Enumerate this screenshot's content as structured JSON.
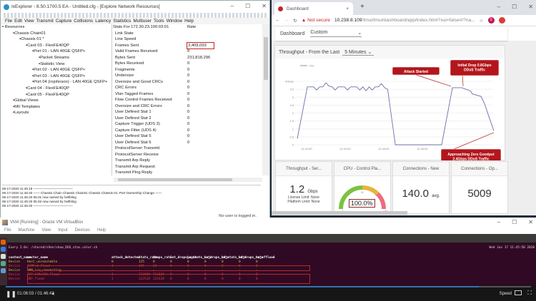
{
  "ixexplorer": {
    "title": "IxExplorer - 8.50.1700.5 EA - Untitled.cfg - [Explore Network Resources]",
    "menu": [
      "File",
      "Edit",
      "View",
      "Transmit",
      "Capture",
      "Collisions",
      "Latency",
      "Statistics",
      "Multiuser",
      "Tools",
      "Window",
      "Help"
    ],
    "tree": [
      {
        "label": "Resources",
        "level": 0
      },
      {
        "label": "Chassis Chain01",
        "level": 1
      },
      {
        "label": "Chassis 01 *",
        "level": 2
      },
      {
        "label": "Card 03 - FlexFE40QP",
        "level": 3
      },
      {
        "label": "Port 01  - LAN 40GE QSFP+",
        "level": 4
      },
      {
        "label": "Packet Streams",
        "level": 5
      },
      {
        "label": "Statistic View",
        "level": 5
      },
      {
        "label": "Port 02  - LAN 40GE QSFP+",
        "level": 4
      },
      {
        "label": "Port 03  - LAN 40GE QSFP+",
        "level": 4
      },
      {
        "label": "Port 04  (rojohnson)  - LAN 40GE QSFP+",
        "level": 4
      },
      {
        "label": "Card 04 - FlexFE40QP",
        "level": 3
      },
      {
        "label": "Card 05 - FlexFE40QP",
        "level": 3
      },
      {
        "label": "Global Views",
        "level": 1
      },
      {
        "label": "MII Templates",
        "level": 1
      },
      {
        "label": "Layouts",
        "level": 1
      }
    ],
    "stats_header": {
      "name": "Stats For 172.30.23.100:03:01",
      "value": "Rate"
    },
    "stats": [
      {
        "name": "Link State",
        "value": ""
      },
      {
        "name": "Line Speed",
        "value": ""
      },
      {
        "name": "Frames Sent",
        "value": "3,409,093",
        "highlight": true
      },
      {
        "name": "Valid Frames Received",
        "value": "0"
      },
      {
        "name": "Bytes Sent",
        "value": "231,818,296"
      },
      {
        "name": "Bytes Received",
        "value": "0"
      },
      {
        "name": "Fragments",
        "value": "0"
      },
      {
        "name": "Undersize",
        "value": "0"
      },
      {
        "name": "Oversize and Good CRCs",
        "value": "0"
      },
      {
        "name": "CRC Errors",
        "value": "0"
      },
      {
        "name": "Vlan Tagged Frames",
        "value": "0"
      },
      {
        "name": "Flow Control Frames Received",
        "value": "0"
      },
      {
        "name": "Oversize and CRC Errors",
        "value": "0"
      },
      {
        "name": "User Defined Stat 1",
        "value": "0"
      },
      {
        "name": "User Defined Stat 2",
        "value": "0"
      },
      {
        "name": "Capture Trigger (UDS 3)",
        "value": "0"
      },
      {
        "name": "Capture Filter (UDS 4)",
        "value": "0"
      },
      {
        "name": "User Defined Stat 5",
        "value": "0"
      },
      {
        "name": "User Defined Stat 6",
        "value": "0"
      },
      {
        "name": "ProtocolServer Transmit",
        "value": ""
      },
      {
        "name": "ProtocolServer Receive",
        "value": ""
      },
      {
        "name": "Transmit Arp Reply",
        "value": ""
      },
      {
        "name": "Transmit Arp Request",
        "value": ""
      },
      {
        "name": "Transmit Ping Reply",
        "value": ""
      }
    ],
    "log": [
      "06-17-2020 11:45:19 ————————————",
      "06-17-2020 11:45:20 ——  Chassis Chain Chassis Chain01 Chassis Chassis 01: Port Ownership Change  ——",
      "06-17-2020 11:45:20  05.01 now owned by hellbling",
      "06-17-2020 11:45:20  05.02 now owned by hellbling",
      "06-17-2020 11:45:20 ————————————"
    ],
    "status": "No user is logged in."
  },
  "browser": {
    "tab_title": "Dashboard",
    "address_warning": "Not secure",
    "url_host": "10.238.8.109",
    "url_path": "/tmui/tmui/dashboard/app/index.html?xui=false#/?na...",
    "profile_initial": "S",
    "dashboard_label": "Dashboard",
    "dashboard_select": "Custom",
    "panel_title": "Throughput - From the Last",
    "range_select": "5 Minutes",
    "cards": [
      {
        "title": "Throughput - Ser...",
        "value": "1.2",
        "unit": "Gbps",
        "lines": [
          "License Limit: None",
          "Platform Limit: None"
        ]
      },
      {
        "title": "CPU - Control Pla...",
        "value": "100.0%",
        "gauge_fraction": 1.0,
        "ticks": [
          "0",
          "50",
          "75",
          "100"
        ]
      },
      {
        "title": "Connections - New",
        "value": "140.0",
        "unit": "avg."
      },
      {
        "title": "Connections - Op...",
        "value": "5009"
      }
    ]
  },
  "chart_data": {
    "type": "line",
    "title": "Throughput - From the Last 5 Minutes",
    "legend": [
      "Out"
    ],
    "legend_position": "top-left",
    "ylabel": "Gbps",
    "ylim": [
      0,
      4
    ],
    "yticks": [
      "0",
      "0.5",
      "1",
      "1.5",
      "2",
      "2.5",
      "3",
      "3.5",
      "4Gbps"
    ],
    "xticks": [
      "11:41:00",
      "11:42:00",
      "11:43:00",
      "11:44:00"
    ],
    "x_unit": "minutes after 11:41:00",
    "xlim": [
      -0.24,
      4.95
    ],
    "series": [
      {
        "name": "Out",
        "color": "#6b6fa8",
        "points": [
          [
            -0.24,
            0.4
          ],
          [
            0.02,
            3.65
          ],
          [
            0.1,
            3.65
          ],
          [
            0.18,
            3.65
          ],
          [
            0.26,
            3.45
          ],
          [
            0.34,
            3.65
          ],
          [
            0.42,
            3.65
          ],
          [
            0.5,
            3.9
          ],
          [
            0.58,
            3.7
          ],
          [
            0.66,
            3.65
          ],
          [
            0.74,
            3.45
          ],
          [
            0.82,
            3.65
          ],
          [
            0.9,
            3.65
          ],
          [
            0.98,
            3.65
          ],
          [
            1.06,
            3.45
          ],
          [
            1.14,
            3.65
          ],
          [
            1.22,
            3.65
          ],
          [
            1.3,
            3.65
          ],
          [
            1.38,
            3.45
          ],
          [
            1.46,
            3.65
          ],
          [
            1.54,
            3.4
          ],
          [
            1.62,
            3.65
          ],
          [
            1.7,
            3.45
          ],
          [
            1.78,
            3.65
          ],
          [
            1.86,
            3.65
          ],
          [
            1.94,
            3.85
          ],
          [
            2.02,
            3.6
          ],
          [
            2.1,
            3.5
          ],
          [
            2.3,
            0
          ],
          [
            3.5,
            0
          ],
          [
            3.78,
            3.6
          ],
          [
            4.02,
            3.6
          ],
          [
            4.24,
            3.4
          ],
          [
            4.3,
            3.2
          ],
          [
            4.52,
            3.05
          ],
          [
            4.61,
            2.6
          ],
          [
            4.72,
            1.8
          ],
          [
            4.85,
            0.9
          ]
        ]
      }
    ],
    "annotations": [
      {
        "text": "Attack Started",
        "x": 3.78
      },
      {
        "text": "Initial Drop 0.8Gbps DDoS Traffic",
        "x": 4.02
      },
      {
        "text": "Approaching Zero Goodput 2.4Gbps DDoS Traffic",
        "x": 4.85
      }
    ]
  },
  "virtualbox": {
    "title": "VM4 [Running] - Oracle VM VirtualBox",
    "menu": [
      "File",
      "Machine",
      "View",
      "Input",
      "Devices",
      "Help"
    ],
    "command": "Every 2.0s: /shared/sVen/show_DOS_stas.color.sh",
    "datetime": "Wed Jun 17 11:45:50 2020",
    "columns": [
      "context_name",
      "vector_name",
      "attack_detected",
      "stats_rate",
      "drops_rate",
      "int_drops_rate",
      "ba_stats_rate",
      "ba_drops_rate",
      "bd_stats_rate",
      "bd_drops_rate",
      "hw_offload"
    ],
    "rows": [
      {
        "cells": [
          "Device",
          "Host_unreachable",
          "0",
          "125",
          "0",
          "0",
          "0",
          "0",
          "0",
          "0",
          "0"
        ],
        "color": "#c3cf3f"
      },
      {
        "cells": [
          "Device",
          "ICMPv4_flood",
          "1",
          "125",
          "23",
          "0",
          "0",
          "0",
          "0",
          "0",
          "0"
        ],
        "color": "#d9453e"
      },
      {
        "cells": [
          "Device",
          "NAN_icw_connecting",
          "-",
          "-",
          "-",
          "-",
          "-",
          "-",
          "-",
          "-",
          "-"
        ],
        "color": "#c3cf3f"
      },
      {
        "cells": [
          "Device",
          "TCP_SYN/ACK_Flood",
          "1",
          "713989",
          "713089",
          "0",
          "0",
          "0",
          "0",
          "0",
          "0"
        ],
        "color": "#d9453e"
      },
      {
        "cells": [
          "Device",
          "UDP_flood",
          "1",
          "222528",
          "222428",
          "0",
          "0",
          "0",
          "0",
          "0",
          "0"
        ],
        "color": "#d9453e"
      }
    ],
    "player_time": "01:06:03 / 01:46:41",
    "speed_label": "Speed"
  }
}
